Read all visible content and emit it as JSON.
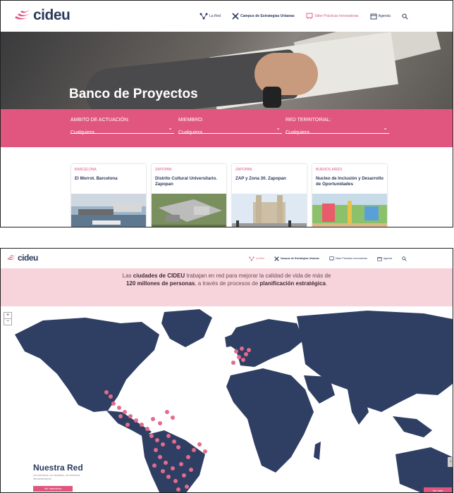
{
  "top_page": {
    "logo_text": "cideu",
    "nav": [
      {
        "label": "La Red",
        "icon": "network-icon"
      },
      {
        "label": "Campus de Estrategias Urbanas",
        "icon": "tools-icon"
      },
      {
        "label": "Taller Prácticas Innovadoras",
        "icon": "workshop-icon"
      },
      {
        "label": "Agenda",
        "icon": "calendar-icon"
      }
    ],
    "search_icon": "search-icon",
    "hero_title": "Banco de Proyectos",
    "filters": [
      {
        "label": "AMBITO DE ACTUACIÓN:",
        "value": "Cualquiera"
      },
      {
        "label": "MIEMBRO:",
        "value": "Cualquiera"
      },
      {
        "label": "RED TERRITORIAL:",
        "value": "Cualquiera"
      }
    ],
    "cards": [
      {
        "location": "BARCELONA",
        "title": "El Morrot. Barcelona"
      },
      {
        "location": "ZAPOPAN",
        "title": "Distrito Cultural Universitario. Zapopan"
      },
      {
        "location": "ZAPOPAN",
        "title": "ZAP y Zona 30. Zapopan"
      },
      {
        "location": "BUENOS AIRES",
        "title": "Nucleo de Inclusión y Desarrollo de Oportunidades"
      }
    ]
  },
  "bottom_page": {
    "logo_text": "cideu",
    "nav": [
      {
        "label": "La Red",
        "icon": "network-icon"
      },
      {
        "label": "Campus de Estrategias Urbanas",
        "icon": "tools-icon"
      },
      {
        "label": "Taller Prácticas Innovadoras",
        "icon": "workshop-icon"
      },
      {
        "label": "Agenda",
        "icon": "calendar-icon"
      }
    ],
    "banner": {
      "p1": "Las ",
      "b1": "ciudades de CIDEU",
      "p2": " trabajan en red para mejorar la calidad de vida de más de ",
      "b2": "120 millones de personas",
      "p3": ", a través de procesos de ",
      "b3": "planificación estratégica",
      "p4": "."
    },
    "zoom_in": "+",
    "zoom_out": "−",
    "section_title": "Nuestra Red",
    "section_text": "xxx miembros, xxx ciudades, xxx territorios iberoamericanos",
    "section_button": "Ver miembros",
    "corner_button": "Ver más",
    "side_arrow": "‹"
  },
  "colors": {
    "brand_pink": "#e0567f",
    "navy": "#2a3a5c",
    "map_land": "#2f3e63",
    "city_dot": "#e56b8d",
    "banner_bg": "#f7d4dc"
  }
}
